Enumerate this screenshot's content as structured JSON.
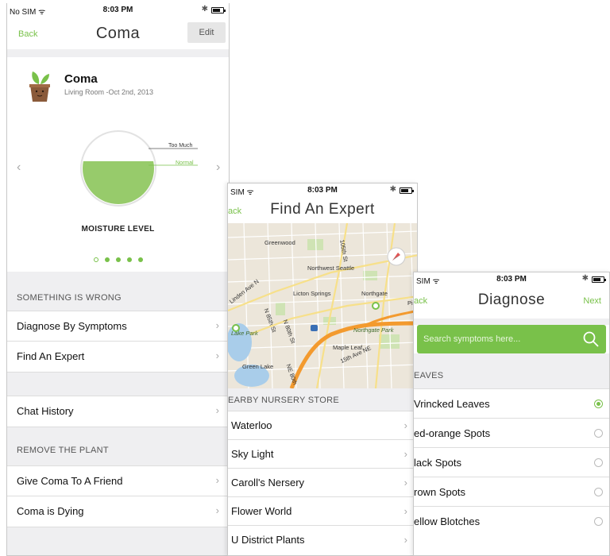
{
  "screen1": {
    "status": {
      "carrier": "No SIM ᯤ",
      "time": "8:03 PM",
      "bt": "✱"
    },
    "nav": {
      "back": "Back",
      "title": "Coma",
      "edit": "Edit"
    },
    "plant": {
      "name": "Coma",
      "subtitle": "Living Room -Oct 2nd, 2013"
    },
    "gauge": {
      "too_much": "Too Much",
      "normal": "Normal",
      "label": "MOISTURE LEVEL",
      "moisture_fraction": 0.6
    },
    "pager": {
      "count": 5,
      "active_index": 0
    },
    "sections": [
      {
        "header": "SOMETHING IS WRONG",
        "rows": [
          "Diagnose By Symptoms",
          "Find An Expert"
        ]
      },
      {
        "header": "",
        "rows": [
          "Chat History"
        ]
      },
      {
        "header": "REMOVE THE PLANT",
        "rows": [
          "Give Coma To A Friend",
          "Coma is Dying"
        ]
      }
    ]
  },
  "screen2": {
    "status": {
      "carrier": "SIM ᯤ",
      "time": "8:03 PM",
      "bt": "✱"
    },
    "nav": {
      "back": "ack",
      "title": "Find An Expert"
    },
    "map_labels": [
      "Greenwood",
      "105th St",
      "Northwest Seattle",
      "Linden Ave N",
      "Licton Springs",
      "N 85th St",
      "N 80th St",
      "Northgate",
      "Pinel",
      "Northgate Park",
      "Lake Park",
      "Maple Leaf",
      "Green Lake",
      "NE 80th",
      "15th Ave NE"
    ],
    "section_header": "EARBY NURSERY STORE",
    "stores": [
      "Waterloo",
      "Sky Light",
      "Caroll's Nersery",
      "Flower World",
      "U District Plants"
    ]
  },
  "screen3": {
    "status": {
      "carrier": "SIM ᯤ",
      "time": "8:03 PM",
      "bt": "✱"
    },
    "nav": {
      "back": "ack",
      "title": "Diagnose",
      "next": "Next"
    },
    "search": {
      "placeholder": "Search symptoms here..."
    },
    "section_header": "EAVES",
    "symptoms": [
      {
        "label": "Vrincked Leaves",
        "selected": true
      },
      {
        "label": "ed-orange Spots",
        "selected": false
      },
      {
        "label": "lack Spots",
        "selected": false
      },
      {
        "label": "rown Spots",
        "selected": false
      },
      {
        "label": "ellow Blotches",
        "selected": false
      }
    ]
  },
  "colors": {
    "accent_green": "#79c14a",
    "gauge_fill": "#97cb6b",
    "section_bg": "#efeff1"
  }
}
